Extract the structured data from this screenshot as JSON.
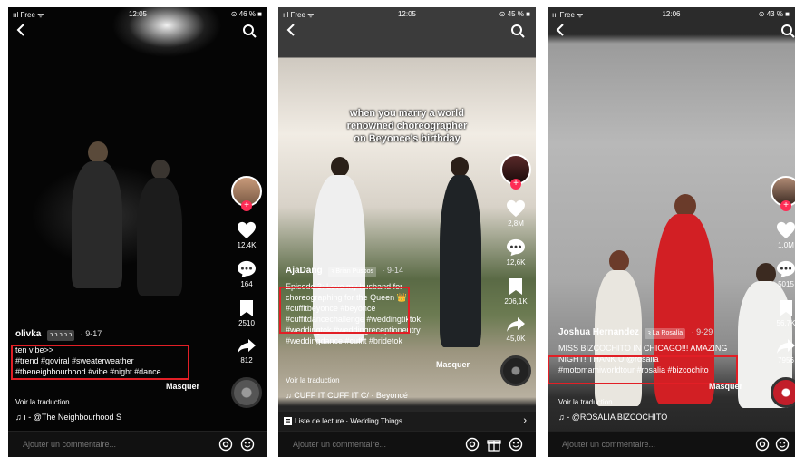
{
  "panel1": {
    "status": {
      "carrier": "ııl Free ᯤ",
      "time": "12:05",
      "battery": "⊙ 46 % ■"
    },
    "actions": {
      "likes": "12,4K",
      "comments": "164",
      "saves": "2510",
      "shares": "812"
    },
    "username": "olivka",
    "tag_pill": "ꝛ ꝛ ꝛ ꝛ ꝛ",
    "date": "· 9-17",
    "caption_line1": "ten vibe>>",
    "caption_line2": "#trend #goviral #sweaterweather",
    "caption_line3": "#theneighbourhood #vibe #night #dance",
    "masquer": "Masquer",
    "translation": "Voir la traduction",
    "music": "♫ ı - @The Neighbourhood   S",
    "comment_placeholder": "Ajouter un commentaire..."
  },
  "panel2": {
    "status": {
      "carrier": "ııl Free ᯤ",
      "time": "12:05",
      "battery": "⊙ 45 % ■"
    },
    "overlay_title_1": "when you marry a world",
    "overlay_title_2": "renowned choreographer",
    "overlay_title_3": "on Beyonce's birthday",
    "actions": {
      "likes": "2,8M",
      "comments": "12,6K",
      "saves": "206,1K",
      "shares": "45,0K"
    },
    "username": "AjaDang",
    "tag_pill": "ꝛ Brian Puspos",
    "date": "· 9-14",
    "caption_line1": "Episode 3: Love my husband for",
    "caption_line2": "choreographing for the Queen 👑",
    "caption_line3": "#cuffitbeyonce #beyonce",
    "caption_line4": "#cuffitdancechallenge #weddingtiktok",
    "caption_line5": "#weddingtok #weddingreceptionentry",
    "caption_line6": "#weddingdance #cuffit #bridetok",
    "masquer": "Masquer",
    "translation": "Voir la traduction",
    "music": "♫ CUFF IT    CUFF IT   C/ · Beyoncé",
    "playlist": "Liste de lecture · Wedding Things",
    "comment_placeholder": "Ajouter un commentaire..."
  },
  "panel3": {
    "status": {
      "carrier": "ııl Free ᯤ",
      "time": "12:06",
      "battery": "⊙ 43 % ■"
    },
    "actions": {
      "likes": "1,0M",
      "comments": "5015",
      "saves": "56,7K",
      "shares": "7956"
    },
    "username": "Joshua Hernandez",
    "tag_pill": "ꝛ La Rosalía",
    "date": "· 9-29",
    "caption_line1": "MISS BIZCOCHITO IN CHICAGO!!! AMAZING",
    "caption_line2": "NIGHT! THANK U @rosalia",
    "caption_line3": "#motomamiworldtour #rosalia #bizcochito",
    "masquer": "Masquer",
    "translation": "Voir la traduction",
    "music": "♫ - @ROSALÍA   BIZCOCHITO",
    "comment_placeholder": "Ajouter un commentaire..."
  },
  "colors": {
    "highlight": "#e21f26",
    "tiktok_red": "#fe2c55"
  },
  "icons": [
    "back-chevron-icon",
    "search-icon",
    "heart-icon",
    "comment-icon",
    "bookmark-icon",
    "share-icon",
    "music-note-icon",
    "at-icon",
    "emoji-icon",
    "gift-icon",
    "playlist-icon"
  ]
}
